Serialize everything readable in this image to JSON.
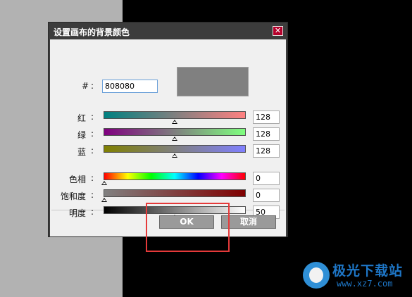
{
  "dialog": {
    "title": "设置画布的背景颜色",
    "close_glyph": "✕",
    "hex_label": "#",
    "colon": ":",
    "hex_value": "808080",
    "preview_color": "#808080",
    "rgb": [
      {
        "label": "红",
        "value": "128",
        "fraction": 0.5
      },
      {
        "label": "绿",
        "value": "128",
        "fraction": 0.5
      },
      {
        "label": "蓝",
        "value": "128",
        "fraction": 0.5
      }
    ],
    "hsl": [
      {
        "label": "色相",
        "value": "0",
        "fraction": 0.0
      },
      {
        "label": "饱和度",
        "value": "0",
        "fraction": 0.0
      },
      {
        "label": "明度",
        "value": "50",
        "fraction": 0.5
      }
    ],
    "ok_label": "OK",
    "cancel_label": "取消"
  },
  "colors": {
    "titlebar": "#3c3c3c",
    "close_button": "#b5002b",
    "highlight_box": "#e53a3a"
  },
  "watermark": {
    "name": "极光下载站",
    "url": "www.xz7.com"
  }
}
